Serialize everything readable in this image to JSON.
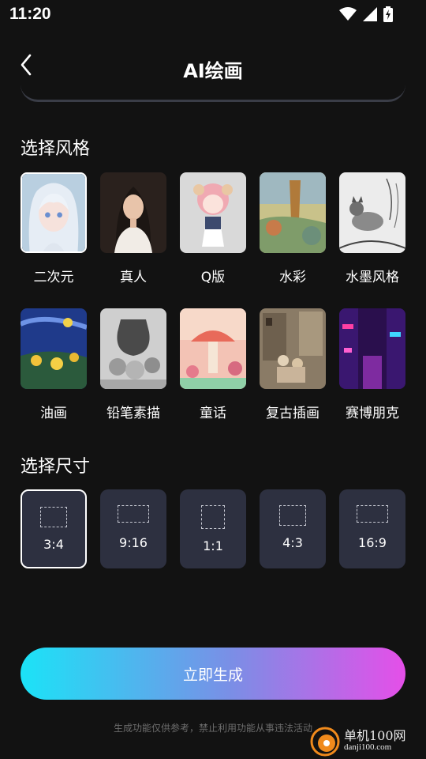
{
  "status_bar": {
    "time": "11:20",
    "icons": [
      "wifi-icon",
      "signal-icon",
      "battery-charging-icon"
    ]
  },
  "header": {
    "title": "AI绘画",
    "back_icon": "chevron-left-icon"
  },
  "style_section": {
    "label": "选择风格",
    "selected_index": 0,
    "styles": [
      {
        "name": "二次元"
      },
      {
        "name": "真人"
      },
      {
        "name": "Q版"
      },
      {
        "name": "水彩"
      },
      {
        "name": "水墨风格"
      },
      {
        "name": "油画"
      },
      {
        "name": "铅笔素描"
      },
      {
        "name": "童话"
      },
      {
        "name": "复古插画"
      },
      {
        "name": "赛博朋克"
      }
    ]
  },
  "size_section": {
    "label": "选择尺寸",
    "selected_index": 0,
    "sizes": [
      {
        "label": "3:4"
      },
      {
        "label": "9:16"
      },
      {
        "label": "1:1"
      },
      {
        "label": "4:3"
      },
      {
        "label": "16:9"
      }
    ]
  },
  "generate_button": {
    "label": "立即生成"
  },
  "disclaimer": "生成功能仅供参考，禁止利用功能从事违法活动",
  "watermark": {
    "main": "单机100网",
    "sub": "danji100.com"
  },
  "colors": {
    "background": "#121212",
    "card": "#2d3040",
    "gradient_start": "#1be3f7",
    "gradient_end": "#e54fe8"
  }
}
